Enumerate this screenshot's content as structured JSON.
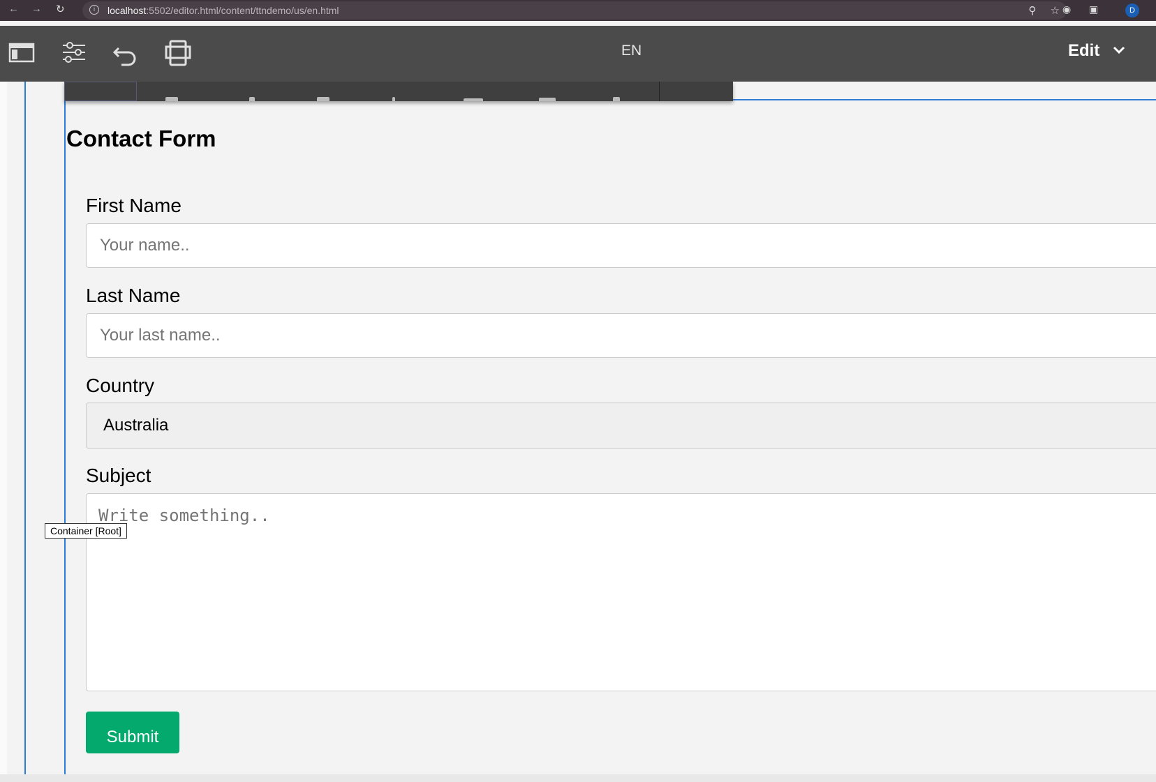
{
  "browser": {
    "back_icon": "arrow-left-icon",
    "forward_icon": "arrow-right-icon",
    "reload_icon": "reload-icon",
    "url_host": "localhost",
    "url_rest": ":5502/editor.html/content/ttndemo/us/en.html",
    "profile_initial": "D"
  },
  "toolbar": {
    "side_panel_icon": "side-panel-icon",
    "properties_icon": "sliders-icon",
    "undo_icon": "undo-icon",
    "emulator_icon": "device-emulator-icon",
    "language": "EN",
    "mode": "Edit",
    "mode_chevron_icon": "chevron-down-icon"
  },
  "form": {
    "title": "Contact Form",
    "first_name_label": "First Name",
    "first_name_placeholder": "Your name..",
    "last_name_label": "Last Name",
    "last_name_placeholder": "Your last name..",
    "country_label": "Country",
    "country_value": "Australia",
    "subject_label": "Subject",
    "subject_placeholder": "Write something..",
    "submit_label": "Submit"
  },
  "tooltip": {
    "text": "Container [Root]"
  },
  "colors": {
    "toolbar_bg": "#4b4b4b",
    "selection_blue": "#2f7cd6",
    "submit_green": "#04aa6d"
  }
}
